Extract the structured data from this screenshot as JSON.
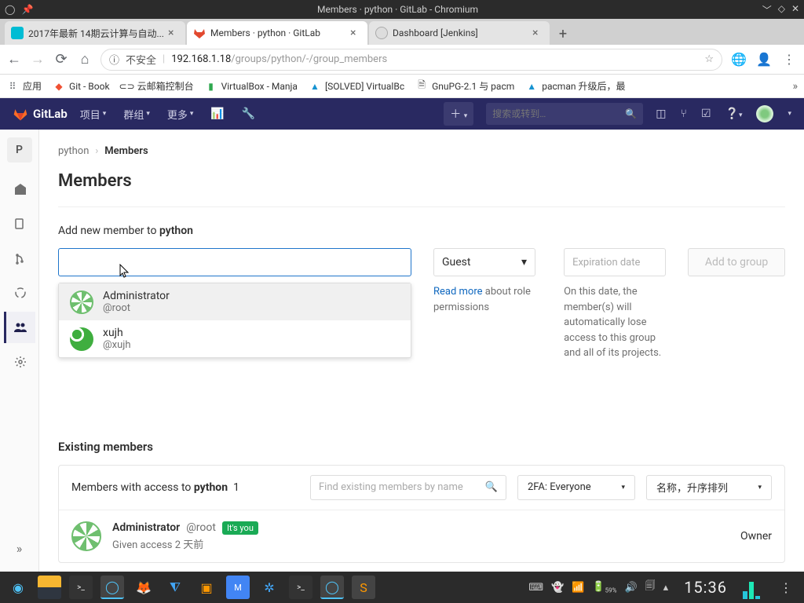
{
  "window": {
    "title": "Members · python · GitLab - Chromium"
  },
  "tabs": [
    {
      "title": "2017年最新 14期云计算与自动...",
      "icon_color": "#00bcd4"
    },
    {
      "title": "Members · python · GitLab",
      "icon_color": "#e2492f"
    },
    {
      "title": "Dashboard [Jenkins]",
      "icon_color": "#888"
    }
  ],
  "toolbar": {
    "insecure_label": "不安全",
    "url_host": "192.168.1.18",
    "url_path": "/groups/python/-/group_members"
  },
  "bookmarks": [
    {
      "label": "应用",
      "color": "#5f6368"
    },
    {
      "label": "Git - Book",
      "color": "#f05033"
    },
    {
      "label": "云邮箱控制台",
      "color": "#333"
    },
    {
      "label": "VirtualBox - Manja",
      "color": "#2fa84f"
    },
    {
      "label": "[SOLVED] VirtualBc",
      "color": "#1793d1"
    },
    {
      "label": "GnuPG-2.1 与 pacm",
      "color": "#555"
    },
    {
      "label": "pacman 升级后，最",
      "color": "#1793d1"
    }
  ],
  "gitlab_header": {
    "brand": "GitLab",
    "menu": {
      "projects": "项目",
      "groups": "群组",
      "more": "更多"
    },
    "search_placeholder": "搜索或转到…"
  },
  "sidebar": {
    "project_letter": "P"
  },
  "breadcrumb": {
    "group": "python",
    "current": "Members"
  },
  "page": {
    "title": "Members",
    "add_label_prefix": "Add new member to ",
    "add_label_group": "python",
    "role_select": "Guest",
    "read_more": "Read more",
    "role_help_suffix": " about role permissions",
    "expiration_placeholder": "Expiration date",
    "expiration_help": "On this date, the member(s) will automatically lose access to this group and all of its projects.",
    "add_button": "Add to group"
  },
  "member_dropdown": [
    {
      "name": "Administrator",
      "handle": "@root"
    },
    {
      "name": "xujh",
      "handle": "@xujh"
    }
  ],
  "existing": {
    "title": "Existing members",
    "count_prefix": "Members with access to ",
    "count_group": "python",
    "count": "1",
    "find_placeholder": "Find existing members by name",
    "filter": "2FA: Everyone",
    "sort": "名称，升序排列"
  },
  "members": [
    {
      "name": "Administrator",
      "handle": "@root",
      "badge": "It's you",
      "given": "Given access 2 天前",
      "role": "Owner"
    }
  ],
  "taskbar": {
    "battery": "59%",
    "clock": "15:36"
  }
}
